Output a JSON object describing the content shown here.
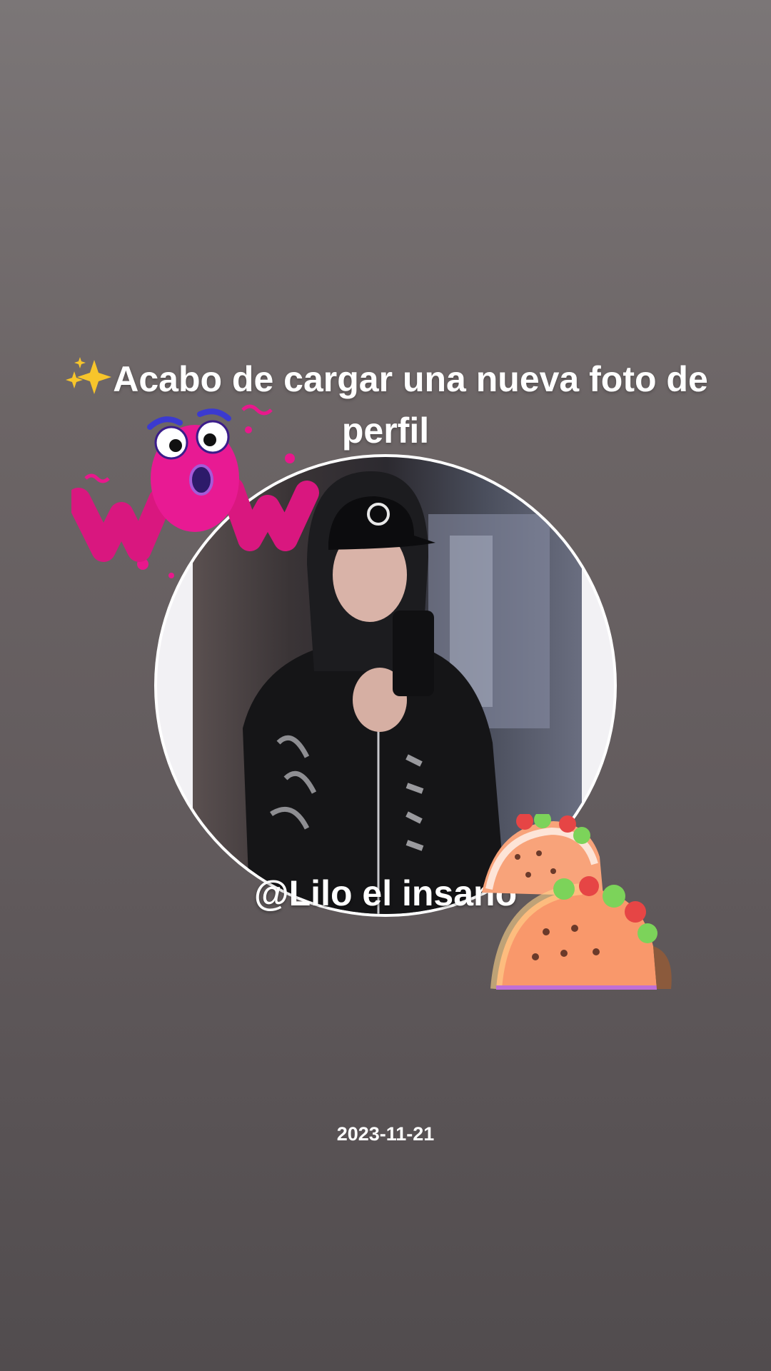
{
  "story": {
    "headline": "Acabo de cargar una nueva foto de perfil",
    "headline_prefix_icon": "sparkles-icon",
    "username": "@Lilo el insano",
    "date": "2023-11-21"
  },
  "stickers": {
    "wow": "wow-frog-sticker",
    "taco": "taco-sticker"
  },
  "colors": {
    "background_top": "#7b7677",
    "background_bottom": "#514c4e",
    "text": "#ffffff",
    "sparkle": "#f7c52b",
    "wow_pink": "#e8188c"
  }
}
